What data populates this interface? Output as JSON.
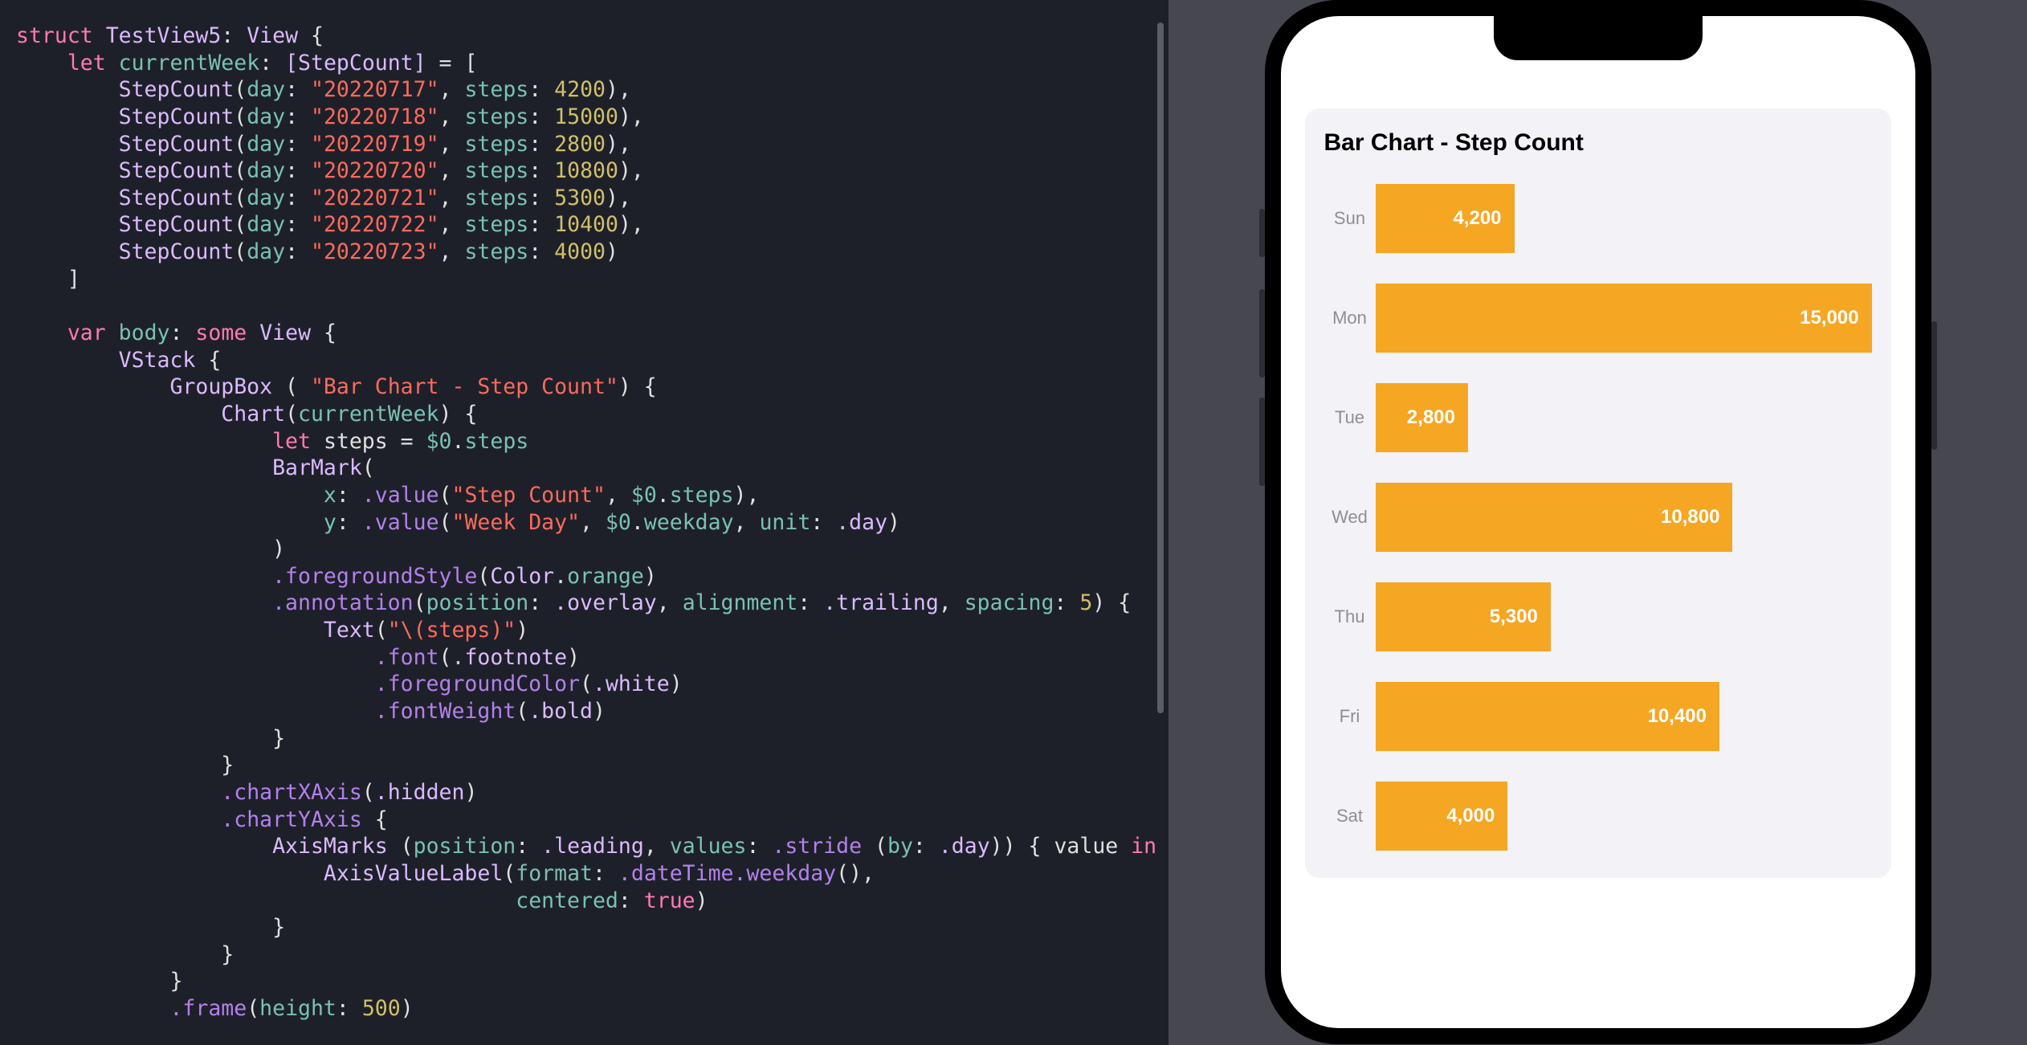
{
  "code": {
    "structName": "TestView5",
    "protocol": "View",
    "propName": "currentWeek",
    "propType": "[StepCount]",
    "entries": [
      {
        "day": "20220717",
        "steps": 4200
      },
      {
        "day": "20220718",
        "steps": 15000
      },
      {
        "day": "20220719",
        "steps": 2800
      },
      {
        "day": "20220720",
        "steps": 10800
      },
      {
        "day": "20220721",
        "steps": 5300
      },
      {
        "day": "20220722",
        "steps": 10400
      },
      {
        "day": "20220723",
        "steps": 4000
      }
    ],
    "bodyKw": "var",
    "bodyName": "body",
    "bodySome": "some",
    "bodyType": "View",
    "vstack": "VStack",
    "groupbox": "GroupBox",
    "groupTitle": "Bar Chart - Step Count",
    "chart": "Chart",
    "chartArg": "currentWeek",
    "letKw": "let",
    "stepsVar": "steps",
    "dollarSteps": "$0.steps",
    "barmark": "BarMark",
    "xLabel": "x",
    "yLabel": "y",
    "valueFn": ".value",
    "stepCountStr": "Step Count",
    "weekDayStr": "Week Day",
    "weekdayProp": "$0.weekday",
    "unit": "unit",
    "day": ".day",
    "fgStyle": ".foregroundStyle",
    "colorOrange": "Color.orange",
    "annotation": ".annotation",
    "position": "position",
    "overlay": ".overlay",
    "alignment": "alignment",
    "trailing": ".trailing",
    "spacing": "spacing",
    "spacingVal": 5,
    "text": "Text",
    "interp": "\"\\(steps)\"",
    "font": ".font",
    "footnote": ".footnote",
    "fgColor": ".foregroundColor",
    "white": ".white",
    "fontWeight": ".fontWeight",
    "bold": ".bold",
    "chartXAxis": ".chartXAxis",
    "hidden": ".hidden",
    "chartYAxis": ".chartYAxis",
    "axisMarks": "AxisMarks",
    "leading": ".leading",
    "values": "values",
    "stride": ".stride",
    "by": "by",
    "value": "value",
    "inKw": "in",
    "axisValueLabel": "AxisValueLabel",
    "format": "format",
    "dateTime": ".dateTime",
    "weekdayFn": ".weekday",
    "centered": "centered",
    "trueKw": "true",
    "frame": ".frame",
    "height": "height",
    "heightVal": 500
  },
  "preview": {
    "title": "Bar Chart - Step Count",
    "barColor": "#f5a623"
  },
  "chart_data": {
    "type": "bar",
    "orientation": "horizontal",
    "title": "Bar Chart - Step Count",
    "xlabel": "Step Count",
    "ylabel": "Week Day",
    "categories": [
      "Sun",
      "Mon",
      "Tue",
      "Wed",
      "Thu",
      "Fri",
      "Sat"
    ],
    "values": [
      4200,
      15000,
      2800,
      10800,
      5300,
      10400,
      4000
    ],
    "value_labels": [
      "4,200",
      "15,000",
      "2,800",
      "10,800",
      "5,300",
      "10,400",
      "4,000"
    ],
    "xlim": [
      0,
      15000
    ],
    "color": "#f5a623"
  }
}
